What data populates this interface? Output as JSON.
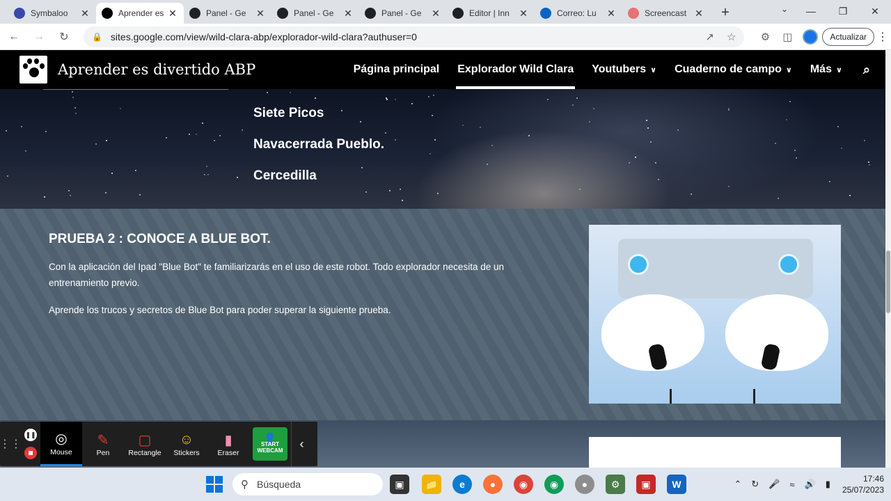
{
  "browser": {
    "tabs": [
      {
        "title": "Symbaloo",
        "fav_color": "#3949ab"
      },
      {
        "title": "Aprender es",
        "fav_color": "#000000",
        "active": true
      },
      {
        "title": "Panel - Ge",
        "fav_color": "#202124"
      },
      {
        "title": "Panel - Ge",
        "fav_color": "#202124"
      },
      {
        "title": "Panel - Ge",
        "fav_color": "#202124"
      },
      {
        "title": "Editor | Inn",
        "fav_color": "#202124"
      },
      {
        "title": "Correo: Lu",
        "fav_color": "#0a64c2"
      },
      {
        "title": "Screencast",
        "fav_color": "#e57373"
      }
    ],
    "url": "sites.google.com/view/wild-clara-abp/explorador-wild-clara?authuser=0",
    "update_label": "Actualizar"
  },
  "site": {
    "title": "Aprender es divertido ABP",
    "nav": [
      {
        "label": "Página principal",
        "active": false,
        "dropdown": false
      },
      {
        "label": "Explorador Wild Clara",
        "active": true,
        "dropdown": false
      },
      {
        "label": "Youtubers",
        "active": false,
        "dropdown": true
      },
      {
        "label": "Cuaderno de campo",
        "active": false,
        "dropdown": true
      },
      {
        "label": "Más",
        "active": false,
        "dropdown": true
      }
    ]
  },
  "places": [
    "Siete Picos",
    "Navacerrada Pueblo.",
    "Cercedilla"
  ],
  "section": {
    "heading": "PRUEBA 2 : CONOCE A BLUE BOT.",
    "para1": "Con la aplicación del Ipad \"Blue Bot\" te familiarizarás en el uso de este robot. Todo explorador necesita de un entrenamiento previo.",
    "para2": "Aprende los trucos y  secretos de Blue Bot para poder superar la siguiente prueba."
  },
  "screencast": {
    "tools": [
      {
        "label": "Mouse",
        "icon": "mouse-icon",
        "active": true
      },
      {
        "label": "Pen",
        "icon": "pen-icon",
        "active": false
      },
      {
        "label": "Rectangle",
        "icon": "rectangle-icon",
        "active": false
      },
      {
        "label": "Stickers",
        "icon": "stickers-icon",
        "active": false
      },
      {
        "label": "Eraser",
        "icon": "eraser-icon",
        "active": false
      }
    ],
    "webcam_line1": "START",
    "webcam_line2": "WEBCAM"
  },
  "taskbar": {
    "search_placeholder": "Búsqueda",
    "time": "17:46",
    "date": "25/07/2023"
  }
}
